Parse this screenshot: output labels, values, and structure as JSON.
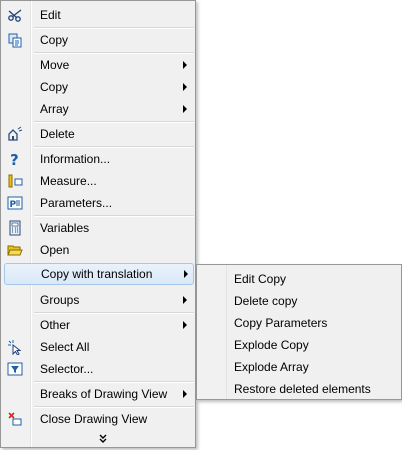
{
  "menu": {
    "items": [
      {
        "label": "Edit",
        "icon": "scissors-edit-icon"
      },
      {
        "label": "Copy",
        "icon": "copy-icon"
      },
      {
        "label": "Move"
      },
      {
        "label": "Copy"
      },
      {
        "label": "Array"
      },
      {
        "label": "Delete",
        "icon": "delete-icon"
      },
      {
        "label": "Information...",
        "icon": "question-icon"
      },
      {
        "label": "Measure...",
        "icon": "measure-icon"
      },
      {
        "label": "Parameters...",
        "icon": "parameters-icon"
      },
      {
        "label": "Variables",
        "icon": "calculator-icon"
      },
      {
        "label": "Open",
        "icon": "folder-open-icon"
      },
      {
        "label": "Copy with translation"
      },
      {
        "label": "Groups"
      },
      {
        "label": "Other"
      },
      {
        "label": "Select All",
        "icon": "select-all-icon"
      },
      {
        "label": "Selector...",
        "icon": "selector-filter-icon"
      },
      {
        "label": "Breaks of Drawing View"
      },
      {
        "label": "Close Drawing View",
        "icon": "close-view-icon"
      }
    ],
    "more_icon": "chevron-double-down-icon"
  },
  "submenu": {
    "parent": "Copy with translation",
    "items": [
      {
        "label": "Edit Copy"
      },
      {
        "label": "Delete copy"
      },
      {
        "label": "Copy Parameters"
      },
      {
        "label": "Explode Copy"
      },
      {
        "label": "Explode Array"
      },
      {
        "label": "Restore deleted elements"
      }
    ]
  },
  "colors": {
    "menu_background": "#f0f0f0",
    "border": "#979797",
    "highlight_fill": "#dce9f8",
    "highlight_border": "#a7c7ea",
    "icon_blue": "#1f5fa8",
    "icon_yellow": "#e8c21a",
    "icon_red": "#d9261c"
  }
}
